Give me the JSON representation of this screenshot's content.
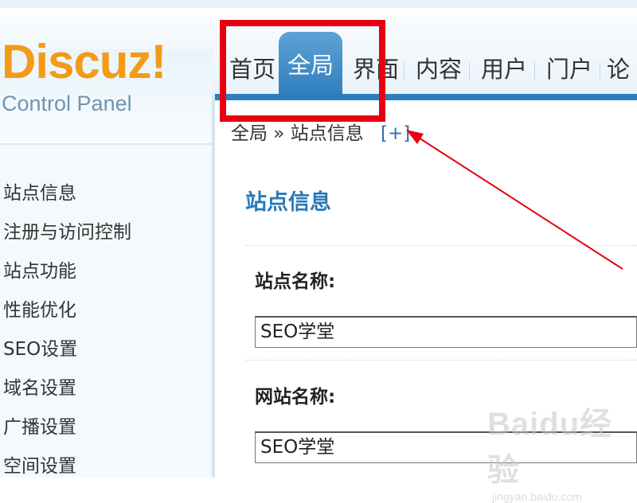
{
  "logo": {
    "name": "Discuz!",
    "subtitle": "Control Panel"
  },
  "nav": {
    "tabs": [
      {
        "label": "首页",
        "active": false
      },
      {
        "label": "全局",
        "active": true
      },
      {
        "label": "界面",
        "active": false
      },
      {
        "label": "内容",
        "active": false
      },
      {
        "label": "用户",
        "active": false
      },
      {
        "label": "门户",
        "active": false
      },
      {
        "label": "论",
        "active": false
      }
    ]
  },
  "breadcrumb": {
    "text": "全局 » 站点信息",
    "plus": "[+]"
  },
  "sidebar": {
    "items": [
      {
        "label": "站点信息"
      },
      {
        "label": "注册与访问控制"
      },
      {
        "label": "站点功能"
      },
      {
        "label": "性能优化"
      },
      {
        "label": "SEO设置"
      },
      {
        "label": "域名设置"
      },
      {
        "label": "广播设置"
      },
      {
        "label": "空间设置"
      }
    ]
  },
  "main": {
    "title": "站点信息",
    "fields": [
      {
        "label": "站点名称:",
        "value": "SEO学堂"
      },
      {
        "label": "网站名称:",
        "value": "SEO学堂"
      }
    ]
  },
  "annotation": {
    "box_color": "#e60012",
    "arrow_color": "#e60012"
  },
  "watermark": {
    "main": "Baidu经验",
    "sub": "jingyan.baidu.com"
  },
  "colors": {
    "accent": "#2f7dbd",
    "logo": "#f39b16",
    "title": "#2a7ab8"
  }
}
